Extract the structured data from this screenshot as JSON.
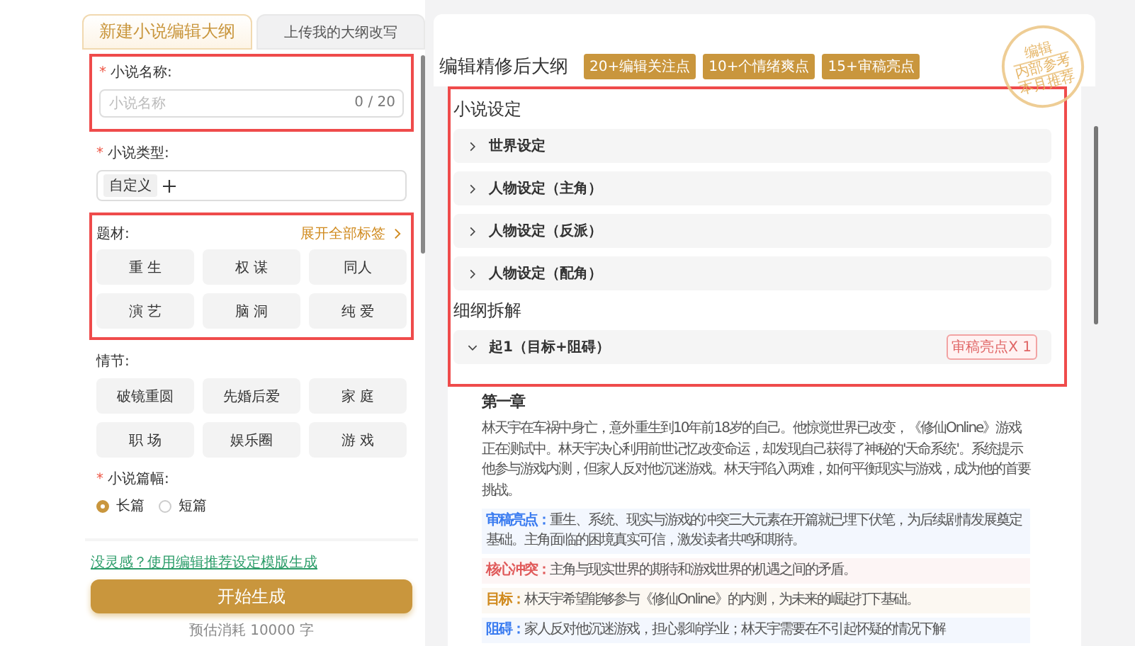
{
  "tabs": [
    {
      "label": "新建小说编辑大纲",
      "selected": true
    },
    {
      "label": "上传我的大纲改写",
      "selected": false
    }
  ],
  "form": {
    "name_field": {
      "label": "小说名称:",
      "required_mark": "*",
      "placeholder": "小说名称",
      "counter": "0 / 20"
    },
    "type_field": {
      "label": "小说类型:",
      "required_mark": "*",
      "tag": "自定义"
    },
    "theme": {
      "label": "题材:",
      "expand_link": "展开全部标签",
      "chips": [
        "重 生",
        "权 谋",
        "同人",
        "演 艺",
        "脑 洞",
        "纯 爱"
      ]
    },
    "plot": {
      "label": "情节:",
      "chips": [
        "破镜重圆",
        "先婚后爱",
        "家 庭",
        "职 场",
        "娱乐圈",
        "游 戏"
      ]
    },
    "length": {
      "label": "小说篇幅:",
      "required_mark": "*",
      "options": [
        {
          "label": "长篇",
          "selected": true
        },
        {
          "label": "短篇",
          "selected": false
        }
      ]
    },
    "template_link": "没灵感？使用编辑推荐设定模版生成",
    "generate_button": "开始生成",
    "estimate": "预估消耗 10000 字"
  },
  "outline": {
    "title": "编辑精修后大纲",
    "badges": [
      "20+编辑关注点",
      "10+个情绪爽点",
      "15+审稿亮点"
    ],
    "stamp": {
      "top": "编辑",
      "middle": "内部参考",
      "bottom": "本月推荐"
    },
    "settings": {
      "title": "小说设定",
      "items": [
        {
          "label": "世界设定",
          "expanded": false
        },
        {
          "label": "人物设定（主角）",
          "expanded": false
        },
        {
          "label": "人物设定（反派）",
          "expanded": false
        },
        {
          "label": "人物设定（配角）",
          "expanded": false
        }
      ]
    },
    "breakdown": {
      "title": "细纲拆解",
      "items": [
        {
          "label": "起1（目标+阻碍）",
          "expanded": true,
          "tag": "审稿亮点X 1"
        }
      ]
    },
    "chapter": {
      "title": "第一章",
      "summary": "林天宇在车祸中身亡，意外重生到10年前18岁的自己。他惊觉世界已改变，《修仙Online》游戏正在测试中。林天宇决心利用前世记忆改变命运，却发现自己获得了神秘的'天命系统'。系统提示他参与游戏内测，但家人反对他沉迷游戏。林天宇陷入两难，如何平衡现实与游戏，成为他的首要挑战。",
      "notes": [
        {
          "label": "审稿亮点：",
          "text": "重生、系统、现实与游戏的冲突三大元素在开篇就已埋下伏笔，为后续剧情发展奠定基础。主角面临的困境真实可信，激发读者共鸣和期待。",
          "color": "#3b7cf0"
        },
        {
          "label": "核心冲突：",
          "text": "主角与现实世界的期待和游戏世界的机遇之间的矛盾。",
          "color": "#e05a5a"
        },
        {
          "label": "目标：",
          "text": "林天宇希望能够参与《修仙Online》的内测，为未来的崛起打下基础。",
          "color": "#d08a1e"
        },
        {
          "label": "阻碍：",
          "text": "家人反对他沉迷游戏，担心影响学业；林天宇需要在不引起怀疑的情况下解",
          "color": "#3b7cf0"
        }
      ]
    }
  }
}
